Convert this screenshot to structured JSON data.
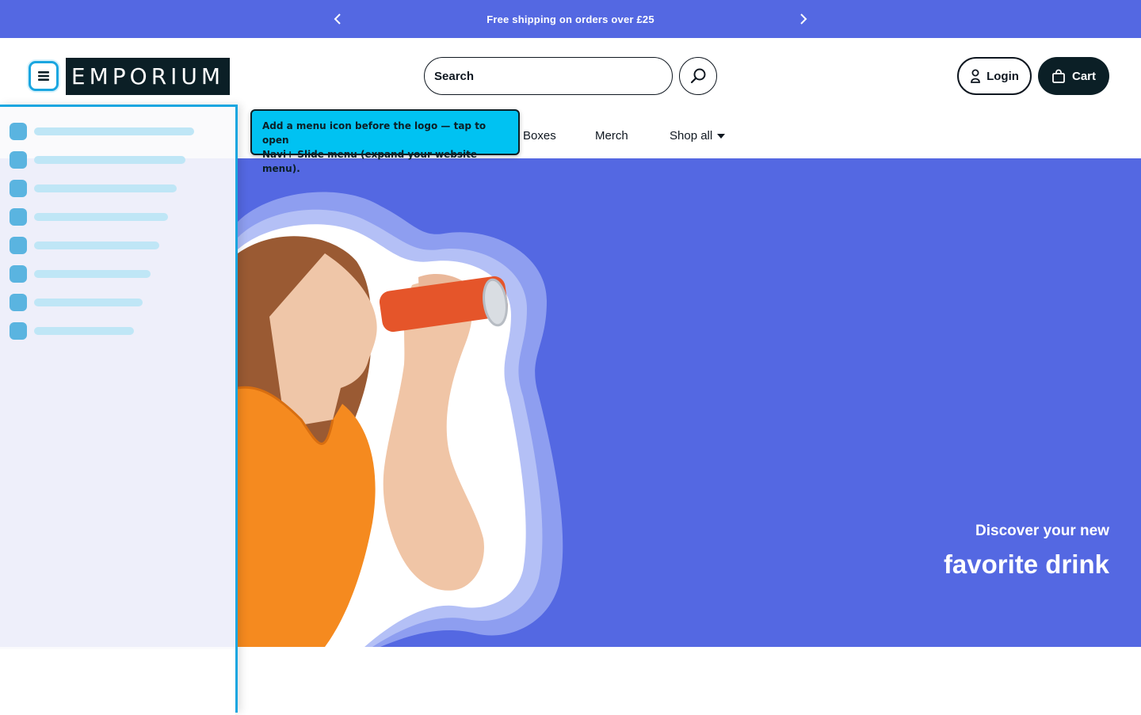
{
  "announcement": {
    "text": "Free shipping on orders over £25",
    "prev_icon": "chevron-left-icon",
    "next_icon": "chevron-right-icon"
  },
  "header": {
    "logo_text": "EMPORIUM",
    "menu_icon": "hamburger-icon",
    "search": {
      "placeholder": "Search",
      "value": "",
      "icon": "search-icon"
    },
    "login_label": "Login",
    "login_icon": "user-icon",
    "cart_label": "Cart",
    "cart_icon": "shopping-bag-icon"
  },
  "nav": {
    "items": [
      {
        "label": "Boxes"
      },
      {
        "label": "Merch"
      },
      {
        "label": "Shop all",
        "icon": "caret-down-icon"
      }
    ]
  },
  "hero": {
    "line1": "Discover your new",
    "line2": "favorite drink",
    "background": "#5468e2"
  },
  "tooltip": {
    "line1": "Add a menu icon before the logo — tap to open",
    "line2": "Navi+ Slide menu (expand your website menu)."
  },
  "colors": {
    "brand_blue": "#5468e2",
    "dark": "#0b1f26",
    "accent_cyan": "#00c2f2",
    "highlight": "#1aa6e0"
  }
}
